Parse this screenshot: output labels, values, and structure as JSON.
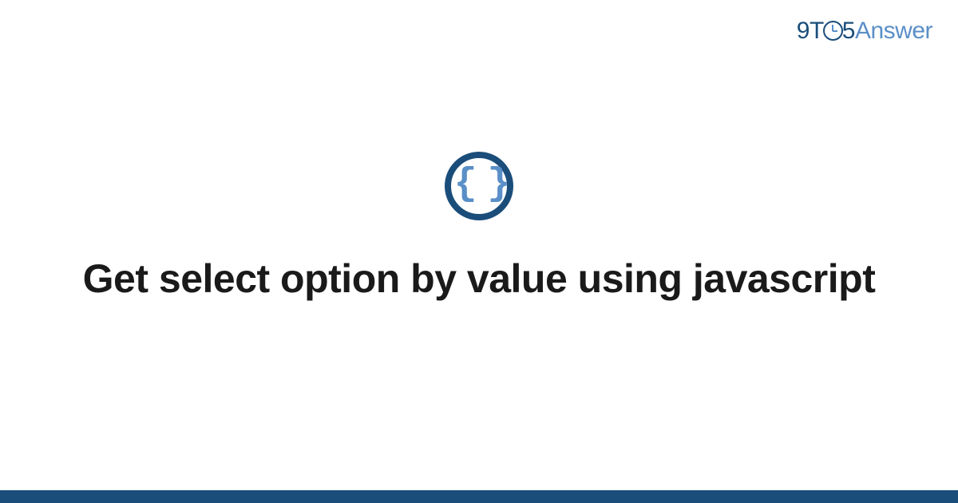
{
  "brand": {
    "nine": "9",
    "t": "T",
    "five": "5",
    "answer": "Answer"
  },
  "icon": {
    "braces": "{ }"
  },
  "title": "Get select option by value using javascript",
  "colors": {
    "primary": "#1a4d7a",
    "accent": "#5a8fc7",
    "text": "#1a1a1a"
  }
}
